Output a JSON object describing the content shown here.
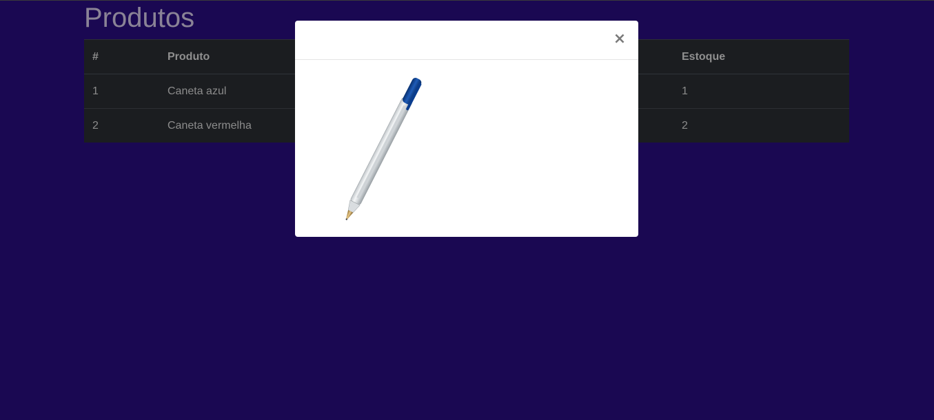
{
  "page": {
    "title": "Produtos"
  },
  "table": {
    "headers": {
      "num": "#",
      "product": "Produto",
      "stock": "Estoque"
    },
    "rows": [
      {
        "num": "1",
        "product": "Caneta azul",
        "stock": "1"
      },
      {
        "num": "2",
        "product": "Caneta vermelha",
        "stock": "2"
      }
    ]
  },
  "modal": {
    "close_symbol": "×",
    "image_icon": "blue-ballpoint-pen-image"
  },
  "colors": {
    "background": "#1a0852",
    "table_background": "#1b1d20",
    "modal_background": "#ffffff",
    "pen_cap": "#0a3d8f"
  }
}
